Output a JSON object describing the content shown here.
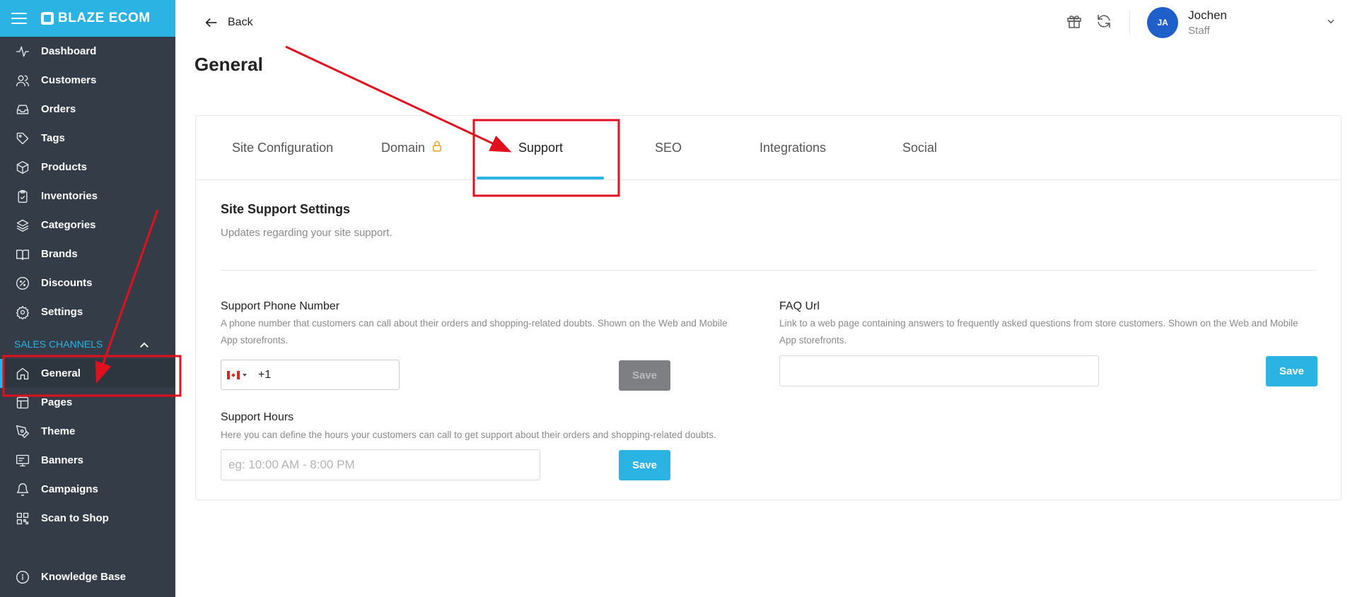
{
  "brand": {
    "name": "BLAZE ECOM"
  },
  "sidebar": {
    "items": [
      {
        "label": "Dashboard",
        "icon": "activity-icon"
      },
      {
        "label": "Customers",
        "icon": "users-icon"
      },
      {
        "label": "Orders",
        "icon": "inbox-icon"
      },
      {
        "label": "Tags",
        "icon": "tag-icon"
      },
      {
        "label": "Products",
        "icon": "box-icon"
      },
      {
        "label": "Inventories",
        "icon": "clipboard-icon"
      },
      {
        "label": "Categories",
        "icon": "layers-icon"
      },
      {
        "label": "Brands",
        "icon": "book-icon"
      },
      {
        "label": "Discounts",
        "icon": "percent-icon"
      },
      {
        "label": "Settings",
        "icon": "gear-icon"
      }
    ],
    "section_title": "SALES CHANNELS",
    "channel_items": [
      {
        "label": "General",
        "icon": "home-icon",
        "active": true
      },
      {
        "label": "Pages",
        "icon": "layout-icon"
      },
      {
        "label": "Theme",
        "icon": "pen-tool-icon"
      },
      {
        "label": "Banners",
        "icon": "monitor-icon"
      },
      {
        "label": "Campaigns",
        "icon": "bell-icon"
      },
      {
        "label": "Scan to Shop",
        "icon": "qr-icon"
      }
    ],
    "footer_item": {
      "label": "Knowledge Base",
      "icon": "info-icon"
    }
  },
  "topbar": {
    "back_label": "Back",
    "user": {
      "initials": "JA",
      "name": "Jochen",
      "role": "Staff"
    }
  },
  "page": {
    "title": "General"
  },
  "tabs": [
    {
      "label": "Site Configuration"
    },
    {
      "label": "Domain",
      "locked": true
    },
    {
      "label": "Support",
      "active": true
    },
    {
      "label": "SEO"
    },
    {
      "label": "Integrations"
    },
    {
      "label": "Social"
    }
  ],
  "support": {
    "title": "Site Support Settings",
    "subtitle": "Updates regarding your site support.",
    "phone": {
      "label": "Support Phone Number",
      "desc_line1": "A phone number that customers can call about their orders and shopping-related doubts. Shown on the Web and Mobile",
      "desc_line2": "App storefronts.",
      "value": "+1",
      "save_label": "Save"
    },
    "faq": {
      "label": "FAQ Url",
      "desc_line1": "Link to a web page containing answers to frequently asked questions from store customers. Shown on the Web and Mobile",
      "desc_line2": "App storefronts.",
      "value": "",
      "save_label": "Save"
    },
    "hours": {
      "label": "Support Hours",
      "desc": "Here you can define the hours your customers can call to get support about their orders and shopping-related doubts.",
      "placeholder": "eg: 10:00 AM - 8:00 PM",
      "save_label": "Save"
    }
  },
  "colors": {
    "brand": "#2bb3e3",
    "sidebar": "#343d47",
    "annotation": "#e0101e",
    "avatar": "#1e5fc9"
  }
}
